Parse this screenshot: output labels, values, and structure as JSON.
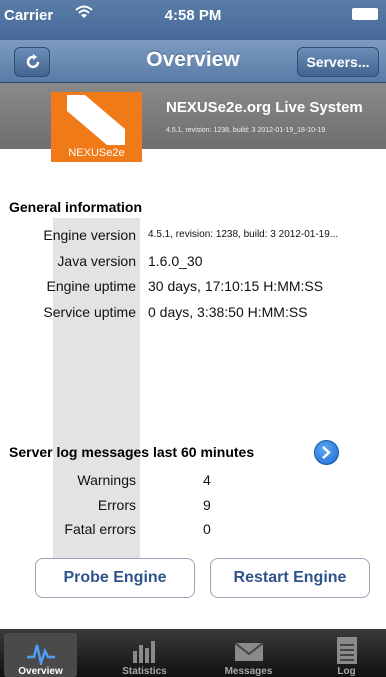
{
  "status_bar": {
    "carrier": "Carrier",
    "time": "4:58 PM"
  },
  "nav": {
    "title": "Overview",
    "servers_label": "Servers..."
  },
  "banner": {
    "logo_text": "NEXUSe2e",
    "system_title": "NEXUSe2e.org Live System",
    "system_subtitle": "4.5.1, revision: 1238, build: 3 2012-01-19_18-10-19"
  },
  "general": {
    "title": "General information",
    "rows": [
      {
        "label": "Engine version",
        "value": "4.5.1, revision: 1238, build: 3 2012-01-19..."
      },
      {
        "label": "Java version",
        "value": "1.6.0_30"
      },
      {
        "label": "Engine uptime",
        "value": "30 days, 17:10:15 H:MM:SS"
      },
      {
        "label": "Service uptime",
        "value": "0 days, 3:38:50 H:MM:SS"
      }
    ]
  },
  "server_log": {
    "title": "Server log messages last 60 minutes",
    "rows": [
      {
        "label": "Warnings",
        "value": "4"
      },
      {
        "label": "Errors",
        "value": "9"
      },
      {
        "label": "Fatal errors",
        "value": "0"
      }
    ]
  },
  "actions": {
    "probe_label": "Probe Engine",
    "restart_label": "Restart Engine"
  },
  "tabs": [
    {
      "label": "Overview",
      "icon": "pulse-icon",
      "selected": true
    },
    {
      "label": "Statistics",
      "icon": "bar-chart-icon",
      "selected": false
    },
    {
      "label": "Messages",
      "icon": "envelope-icon",
      "selected": false
    },
    {
      "label": "Log",
      "icon": "notepad-icon",
      "selected": false
    }
  ],
  "colors": {
    "accent": "#30548a",
    "logo": "#f07a17",
    "nav": "#5a7ba7"
  }
}
